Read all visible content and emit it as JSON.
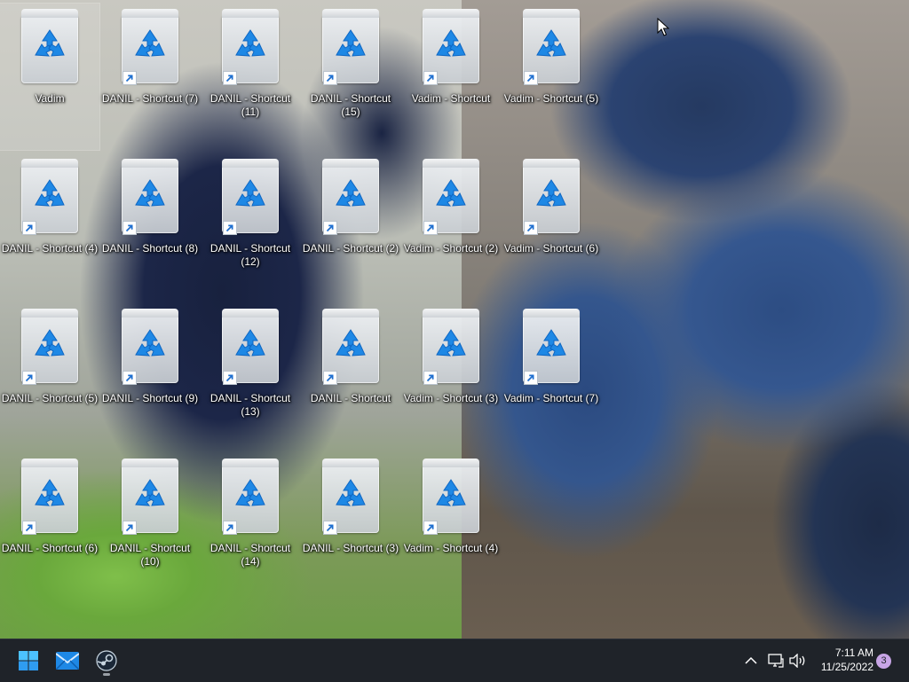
{
  "desktop": {
    "icons": [
      {
        "label": "Vadim",
        "shortcut": false,
        "selected": true
      },
      {
        "label": "DANIL - Shortcut (7)",
        "shortcut": true
      },
      {
        "label": "DANIL - Shortcut (11)",
        "shortcut": true
      },
      {
        "label": "DANIL - Shortcut (15)",
        "shortcut": true
      },
      {
        "label": "Vadim - Shortcut",
        "shortcut": true
      },
      {
        "label": "Vadim - Shortcut (5)",
        "shortcut": true
      },
      {
        "label": "DANIL - Shortcut (4)",
        "shortcut": true
      },
      {
        "label": "DANIL - Shortcut (8)",
        "shortcut": true
      },
      {
        "label": "DANIL - Shortcut (12)",
        "shortcut": true
      },
      {
        "label": "DANIL - Shortcut (2)",
        "shortcut": true
      },
      {
        "label": "Vadim - Shortcut (2)",
        "shortcut": true
      },
      {
        "label": "Vadim - Shortcut (6)",
        "shortcut": true
      },
      {
        "label": "DANIL - Shortcut (5)",
        "shortcut": true
      },
      {
        "label": "DANIL - Shortcut (9)",
        "shortcut": true
      },
      {
        "label": "DANIL - Shortcut (13)",
        "shortcut": true
      },
      {
        "label": "DANIL - Shortcut",
        "shortcut": true
      },
      {
        "label": "Vadim - Shortcut (3)",
        "shortcut": true
      },
      {
        "label": "Vadim - Shortcut (7)",
        "shortcut": true
      },
      {
        "label": "DANIL - Shortcut (6)",
        "shortcut": true
      },
      {
        "label": "DANIL - Shortcut (10)",
        "shortcut": true
      },
      {
        "label": "DANIL - Shortcut (14)",
        "shortcut": true
      },
      {
        "label": "DANIL - Shortcut (3)",
        "shortcut": true
      },
      {
        "label": "Vadim - Shortcut (4)",
        "shortcut": true
      }
    ],
    "icon_name": "recycle-bin-icon"
  },
  "taskbar": {
    "pinned": [
      {
        "name": "start-icon",
        "color": "#3aa0ff"
      },
      {
        "name": "mail-icon",
        "color": "#1e88e5"
      },
      {
        "name": "steam-icon",
        "color": "#c7d5e0",
        "running": true
      }
    ],
    "tray": {
      "overflow_icon": "chevron-up-icon",
      "network_icon": "network-icon",
      "volume_icon": "volume-icon",
      "time": "7:11 AM",
      "date": "11/25/2022",
      "notification_count": "3"
    }
  },
  "colors": {
    "taskbar_bg": "#1f2329",
    "recycle_blue": "#1e88e5",
    "badge": "#c8a5e6"
  }
}
